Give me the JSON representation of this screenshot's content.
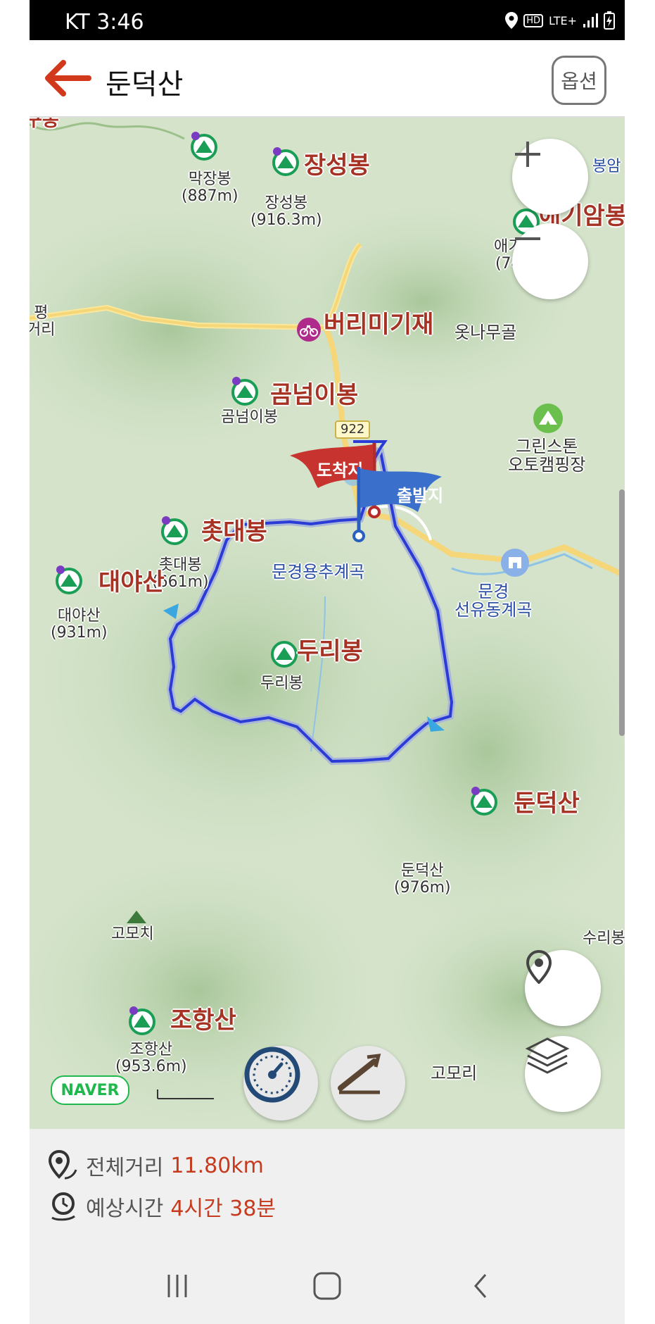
{
  "status": {
    "carrier_time": "KT  3:46",
    "network": "LTE+"
  },
  "header": {
    "title": "둔덕산",
    "option_label": "옵션"
  },
  "map": {
    "flags": {
      "arrival": "도착지",
      "departure": "출발지"
    },
    "road_number": "922",
    "labels": {
      "jangseongbong_big": "장성봉",
      "jangseongbong_sm": "장성봉\n(916.3m)",
      "makjangbong_sm": "막장봉\n(887m)",
      "aegiambong_big": "애기암봉",
      "aegiambong_sm": "애기\n(74",
      "bongam": "봉암",
      "pyeong": "평\n거리",
      "burimigijae": "버리미기재",
      "otnamugol": "옷나무골",
      "gomnimibong_big": "곰넘이봉",
      "gomnimibong_sm": "곰넘이봉",
      "greenstone": "그린스톤\n오토캠핑장",
      "chokdaebong_big": "촛대봉",
      "chokdaebong_sm": "촛대봉\n(661m)",
      "daeyasan_big": "대야산",
      "daeyasan_sm": "대야산\n(931m)",
      "yongchu": "문경용추계곡",
      "seonyudong": "문경\n선유동계곡",
      "duribong_big": "두리봉",
      "duribong_sm": "두리봉",
      "dundeoksan_big": "둔덕산",
      "dundeoksan_sm": "둔덕산\n(976m)",
      "gomochi": "고모치",
      "suribong": "수리봉",
      "johangsan_big": "조항산",
      "johangsan_sm": "조항산\n(953.6m)",
      "gomori": "고모리",
      "top_left": "구봉"
    },
    "naver_logo": "NAVER",
    "route_color": "#2a3bd6"
  },
  "info": {
    "distance_label": "전체거리",
    "distance_value": "11.80km",
    "time_label": "예상시간",
    "time_value": "4시간 38분"
  }
}
